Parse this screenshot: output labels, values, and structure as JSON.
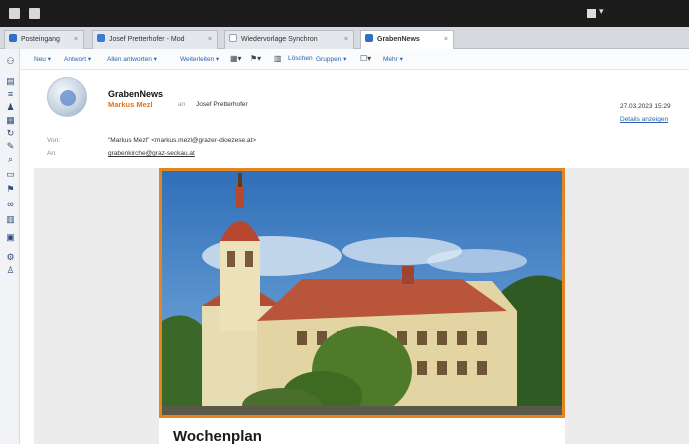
{
  "tabs": [
    {
      "label": "Posteingang",
      "icon": "inbox-icon",
      "color": "#2f6fc1"
    },
    {
      "label": "Josef Pretterhofer - Mod",
      "icon": "calendar-icon",
      "color": "#3a7bd5"
    },
    {
      "label": "Wiedervorlage Synchron",
      "icon": "document-icon",
      "color": "#9aa3ad"
    },
    {
      "label": "GrabenNews",
      "icon": "mail-open-icon",
      "color": "#2f6fc1"
    }
  ],
  "toolbar": {
    "neu": "Neu ▾",
    "antworten": "Antwort ▾",
    "weiterleiten": "Allen antworten ▾",
    "weiterleiten2": "Weiterleiten ▾",
    "loeschen": "Löschen",
    "gruppen": "Gruppen ▾",
    "mehr": "Mehr ▾"
  },
  "message": {
    "subject": "GrabenNews",
    "sender": "Markus Mezl",
    "via": "an",
    "project": "Josef Pretterhofer",
    "date": "27.03.2023 15:29",
    "contact_link": "Details anzeigen",
    "from_label": "Von:",
    "from_value": "\"Markus Mezl\" <markus.mezl@grazer-dioezese.at>",
    "to_label": "An:",
    "to_value": "grabenkirche@graz-seckau.at"
  },
  "body": {
    "heading": "Wochenplan"
  },
  "colors": {
    "accent": "#e58522",
    "link": "#2a63ad"
  }
}
